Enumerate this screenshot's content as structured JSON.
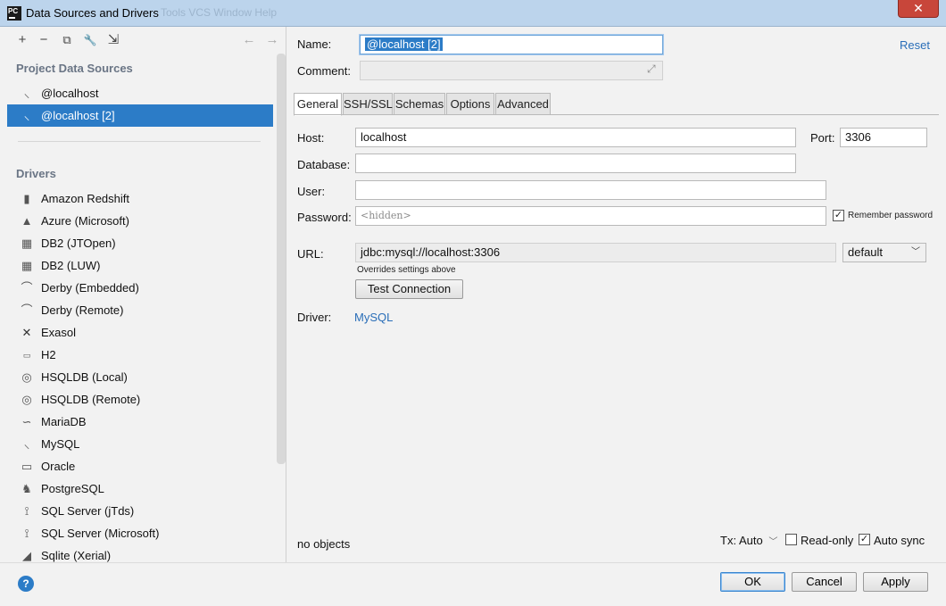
{
  "window": {
    "title": "Data Sources and Drivers",
    "app_icon": "pc-icon",
    "ghost_menu": "Tools   VCS   Window   Help",
    "close_glyph": "✕"
  },
  "toolbar": {
    "add": "+",
    "remove": "−",
    "copy": "⧉",
    "settings": "🔧",
    "import": "⇲",
    "back": "←",
    "forward": "→"
  },
  "left": {
    "project_header": "Project Data Sources",
    "project_items": [
      {
        "label": "@localhost",
        "icon": "mysql-icon"
      },
      {
        "label": "@localhost [2]",
        "icon": "mysql-icon",
        "selected": true
      }
    ],
    "drivers_header": "Drivers",
    "drivers": [
      {
        "label": "Amazon Redshift",
        "icon": "redshift-icon"
      },
      {
        "label": "Azure (Microsoft)",
        "icon": "azure-icon"
      },
      {
        "label": "DB2 (JTOpen)",
        "icon": "db2-icon"
      },
      {
        "label": "DB2 (LUW)",
        "icon": "db2-icon"
      },
      {
        "label": "Derby (Embedded)",
        "icon": "derby-icon"
      },
      {
        "label": "Derby (Remote)",
        "icon": "derby-icon"
      },
      {
        "label": "Exasol",
        "icon": "exasol-icon"
      },
      {
        "label": "H2",
        "icon": "h2-icon"
      },
      {
        "label": "HSQLDB (Local)",
        "icon": "hsqldb-icon"
      },
      {
        "label": "HSQLDB (Remote)",
        "icon": "hsqldb-icon"
      },
      {
        "label": "MariaDB",
        "icon": "mariadb-icon"
      },
      {
        "label": "MySQL",
        "icon": "mysql-icon"
      },
      {
        "label": "Oracle",
        "icon": "oracle-icon"
      },
      {
        "label": "PostgreSQL",
        "icon": "postgresql-icon"
      },
      {
        "label": "SQL Server (jTds)",
        "icon": "sqlserver-icon"
      },
      {
        "label": "SQL Server (Microsoft)",
        "icon": "sqlserver-icon"
      },
      {
        "label": "Sqlite (Xerial)",
        "icon": "sqlite-icon"
      }
    ]
  },
  "form": {
    "name_label": "Name:",
    "name_value": "@localhost [2]",
    "comment_label": "Comment:",
    "comment_value": "",
    "reset_link": "Reset",
    "tabs": [
      "General",
      "SSH/SSL",
      "Schemas",
      "Options",
      "Advanced"
    ],
    "active_tab": "General",
    "host_label": "Host:",
    "host_value": "localhost",
    "port_label": "Port:",
    "port_value": "3306",
    "database_label": "Database:",
    "database_value": "",
    "user_label": "User:",
    "user_value": "",
    "password_label": "Password:",
    "password_placeholder": "<hidden>",
    "remember_password": "Remember password",
    "remember_checked": true,
    "url_label": "URL:",
    "url_value": "jdbc:mysql://localhost:3306",
    "url_mode": "default",
    "url_hint": "Overrides settings above",
    "test_connection": "Test Connection",
    "driver_label": "Driver:",
    "driver_link": "MySQL",
    "status": "no objects",
    "tx_label": "Tx: Auto",
    "read_only": "Read-only",
    "read_only_checked": false,
    "auto_sync": "Auto sync",
    "auto_sync_checked": true
  },
  "buttons": {
    "help": "?",
    "ok": "OK",
    "cancel": "Cancel",
    "apply": "Apply"
  }
}
